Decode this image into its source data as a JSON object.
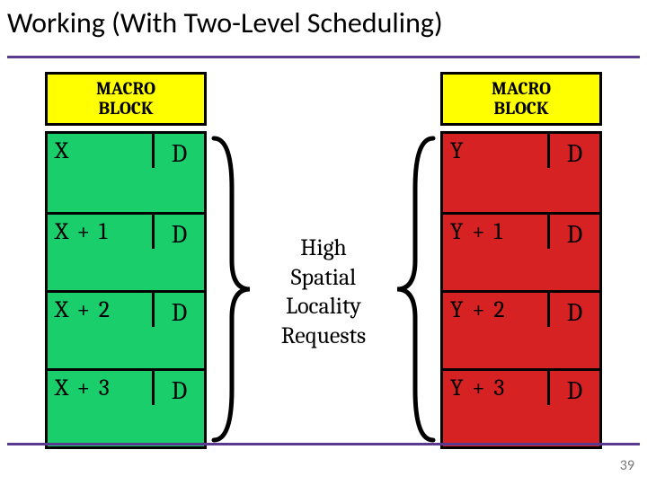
{
  "title": "Working (With Two-Level Scheduling)",
  "pagenum": "39",
  "header_left": "MACRO\nBLOCK",
  "header_right": "MACRO\nBLOCK",
  "left_rows": [
    {
      "addr": "X",
      "d": "D"
    },
    {
      "addr": "X + 1",
      "d": "D"
    },
    {
      "addr": "X + 2",
      "d": "D"
    },
    {
      "addr": "X + 3",
      "d": "D"
    }
  ],
  "right_rows": [
    {
      "addr": "Y",
      "d": "D"
    },
    {
      "addr": "Y + 1",
      "d": "D"
    },
    {
      "addr": "Y + 2",
      "d": "D"
    },
    {
      "addr": "Y + 3",
      "d": "D"
    }
  ],
  "center_caption": "High\nSpatial\nLocality\nRequests",
  "colors": {
    "header_bg": "#ffff00",
    "left_bg": "#19ce6b",
    "right_bg": "#d62222",
    "rule": "#5a3a90"
  }
}
